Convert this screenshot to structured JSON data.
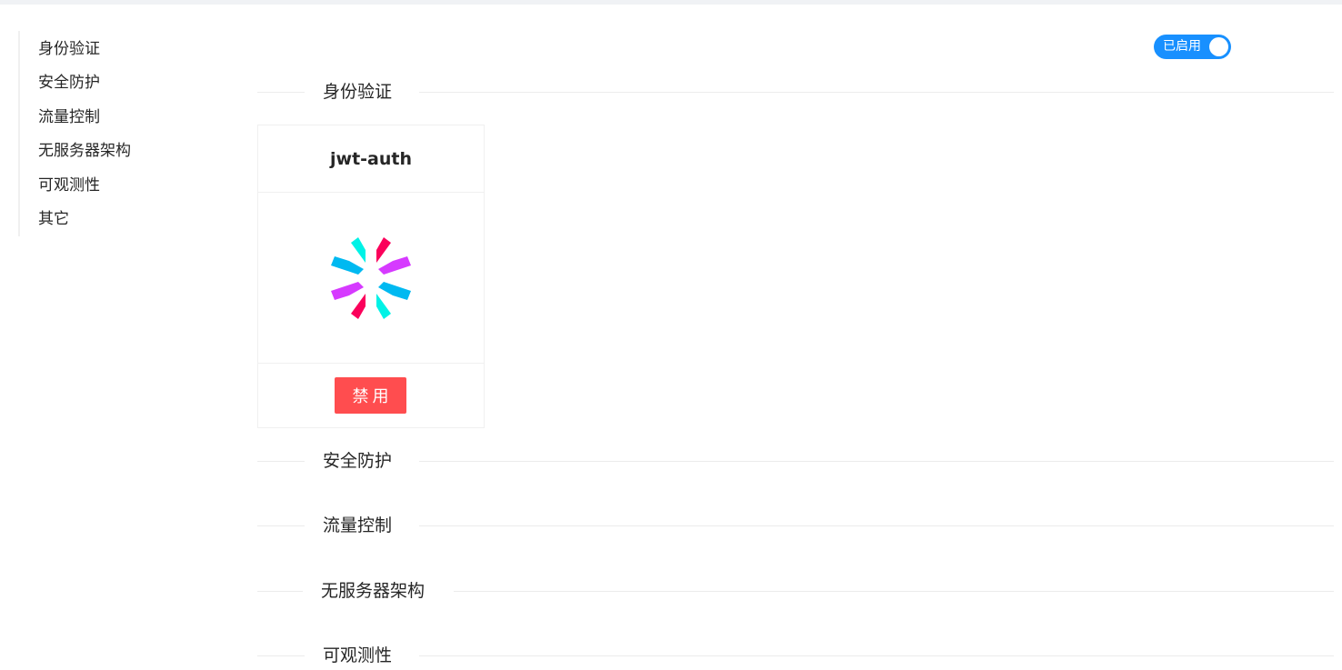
{
  "sidebar": {
    "items": [
      {
        "label": "身份验证"
      },
      {
        "label": "安全防护"
      },
      {
        "label": "流量控制"
      },
      {
        "label": "无服务器架构"
      },
      {
        "label": "可观测性"
      },
      {
        "label": "其它"
      }
    ]
  },
  "toggle": {
    "label": "已启用",
    "enabled": true,
    "color": "#1890ff"
  },
  "sections": [
    {
      "title": "身份验证"
    },
    {
      "title": "安全防护"
    },
    {
      "title": "流量控制"
    },
    {
      "title": "无服务器架构"
    },
    {
      "title": "可观测性"
    }
  ],
  "plugin_card": {
    "name": "jwt-auth",
    "icon": "jwt-logo-icon",
    "button_label": "禁用",
    "button_color": "#ff4d4f"
  }
}
